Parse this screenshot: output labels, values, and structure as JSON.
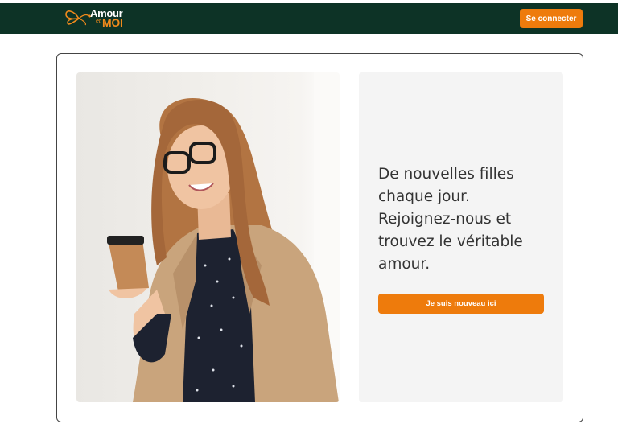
{
  "header": {
    "logo": {
      "word_top": "Amour",
      "word_mid": "et",
      "word_bottom": "MOI"
    },
    "login_label": "Se connecter"
  },
  "hero": {
    "headline": "De nouvelles filles chaque jour. Rejoignez-nous et trouvez le véritable amour.",
    "cta_label": "Je suis nouveau ici"
  },
  "colors": {
    "header_bg": "#0d3326",
    "accent": "#ee7b0c",
    "panel_bg": "#f4f4f4"
  },
  "icons": [
    "butterfly-logo-icon"
  ]
}
